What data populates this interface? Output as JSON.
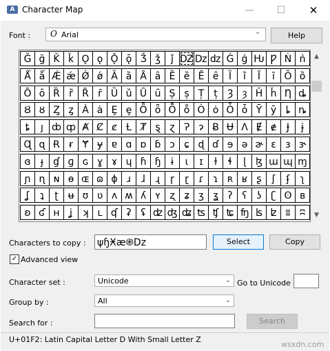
{
  "window": {
    "title": "Character Map",
    "minimize_glyph": "—",
    "maximize_glyph": "☐",
    "close_glyph": "✕"
  },
  "font": {
    "label": "Font :",
    "icon_glyph": "O",
    "value": "Arial",
    "help_label": "Help"
  },
  "grid": {
    "columns": 20,
    "selected_index": 11,
    "rows": [
      [
        "Ğ",
        "ğ",
        "Ǩ",
        "ǩ",
        "Ǫ",
        "ǫ",
        "Ǭ",
        "ǭ",
        "Ǯ",
        "ǯ",
        "ǰ",
        "Ǳ",
        "ǲ",
        "ǳ",
        "Ǵ",
        "ǵ",
        "Ƕ",
        "Ƿ",
        "Ǹ",
        "ǹ"
      ],
      [
        "Ǻ",
        "ǻ",
        "Ǽ",
        "ǽ",
        "Ǿ",
        "ǿ",
        "Ȁ",
        "ȁ",
        "Ȃ",
        "ȃ",
        "Ȅ",
        "ȅ",
        "Ȇ",
        "ȇ",
        "Ȉ",
        "ȉ",
        "Ȋ",
        "ȋ",
        "Ȍ",
        "ȍ"
      ],
      [
        "Ȏ",
        "ȏ",
        "Ȑ",
        "ȑ",
        "Ȓ",
        "ȓ",
        "Ȕ",
        "ȕ",
        "Ȗ",
        "ȗ",
        "Ș",
        "ș",
        "Ț",
        "ț",
        "Ȝ",
        "ȝ",
        "Ȟ",
        "ȟ",
        "Ƞ",
        "ȡ"
      ],
      [
        "Ȣ",
        "ȣ",
        "Ȥ",
        "ȥ",
        "Ȧ",
        "ȧ",
        "Ȩ",
        "ȩ",
        "Ȫ",
        "ȫ",
        "Ȭ",
        "ȭ",
        "Ȯ",
        "ȯ",
        "Ȱ",
        "ȱ",
        "Ȳ",
        "ȳ",
        "ȴ",
        "ȵ"
      ],
      [
        "ȶ",
        "ȷ",
        "ȸ",
        "ȹ",
        "Ⱥ",
        "Ȼ",
        "ȼ",
        "Ƚ",
        "Ⱦ",
        "ȿ",
        "ɀ",
        "Ɂ",
        "ɂ",
        "Ƀ",
        "Ʉ",
        "Ʌ",
        "Ɇ",
        "ɇ",
        "Ɉ",
        "ɉ"
      ],
      [
        "Ɋ",
        "ɋ",
        "Ɍ",
        "ɍ",
        "Ɏ",
        "ɏ",
        "ɐ",
        "ɑ",
        "ɒ",
        "ɓ",
        "ɔ",
        "ɕ",
        "ɖ",
        "ɗ",
        "ɘ",
        "ə",
        "ɚ",
        "ɛ",
        "ɜ",
        "ɝ"
      ],
      [
        "ɞ",
        "ɟ",
        "ɠ",
        "ɡ",
        "ɢ",
        "ɣ",
        "ɤ",
        "ɥ",
        "ɦ",
        "ɧ",
        "ɨ",
        "ɩ",
        "ɪ",
        "ɫ",
        "ɬ",
        "ɭ",
        "ɮ",
        "ɯ",
        "ɰ",
        "ɱ"
      ],
      [
        "ɲ",
        "ɳ",
        "ɴ",
        "ɵ",
        "ɶ",
        "ɷ",
        "ɸ",
        "ɹ",
        "ɺ",
        "ɻ",
        "ɼ",
        "ɽ",
        "ɾ",
        "ɿ",
        "ʀ",
        "ʁ",
        "ʂ",
        "ʃ",
        "ʄ",
        "ʅ"
      ],
      [
        "ʆ",
        "ʇ",
        "ʈ",
        "ʉ",
        "ʊ",
        "ʋ",
        "ʌ",
        "ʍ",
        "ʎ",
        "ʏ",
        "ʐ",
        "ʑ",
        "ʒ",
        "ʓ",
        "ʔ",
        "ʕ",
        "ʖ",
        "ʗ",
        "ʘ",
        "ʙ"
      ],
      [
        "ʚ",
        "ʛ",
        "ʜ",
        "ʝ",
        "ʞ",
        "ʟ",
        "ʠ",
        "ʡ",
        "ʢ",
        "ʣ",
        "ʤ",
        "ʥ",
        "ʦ",
        "ʧ",
        "ʨ",
        "ʩ",
        "ʪ",
        "ʫ",
        "ʬ",
        "ʭ"
      ]
    ]
  },
  "scrollbar": {
    "up_glyph": "▲",
    "down_glyph": "▼"
  },
  "copy": {
    "label": "Characters to copy :",
    "value": "ψɧӾæ֎Dz",
    "select_label": "Select",
    "copy_label": "Copy"
  },
  "advanced": {
    "checked": true,
    "check_glyph": "✓",
    "label": "Advanced view"
  },
  "charset": {
    "label": "Character set :",
    "value": "Unicode"
  },
  "goto_unicode": {
    "label": "Go to Unicode :",
    "value": ""
  },
  "groupby": {
    "label": "Group by :",
    "value": "All"
  },
  "search": {
    "label": "Search for :",
    "value": "",
    "button_label": "Search"
  },
  "combo_arrow_glyph": "⌄",
  "status": {
    "text": "U+01F2: Latin Capital Letter D With Small Letter Z"
  },
  "watermark": {
    "text": "wsxdn.com"
  }
}
